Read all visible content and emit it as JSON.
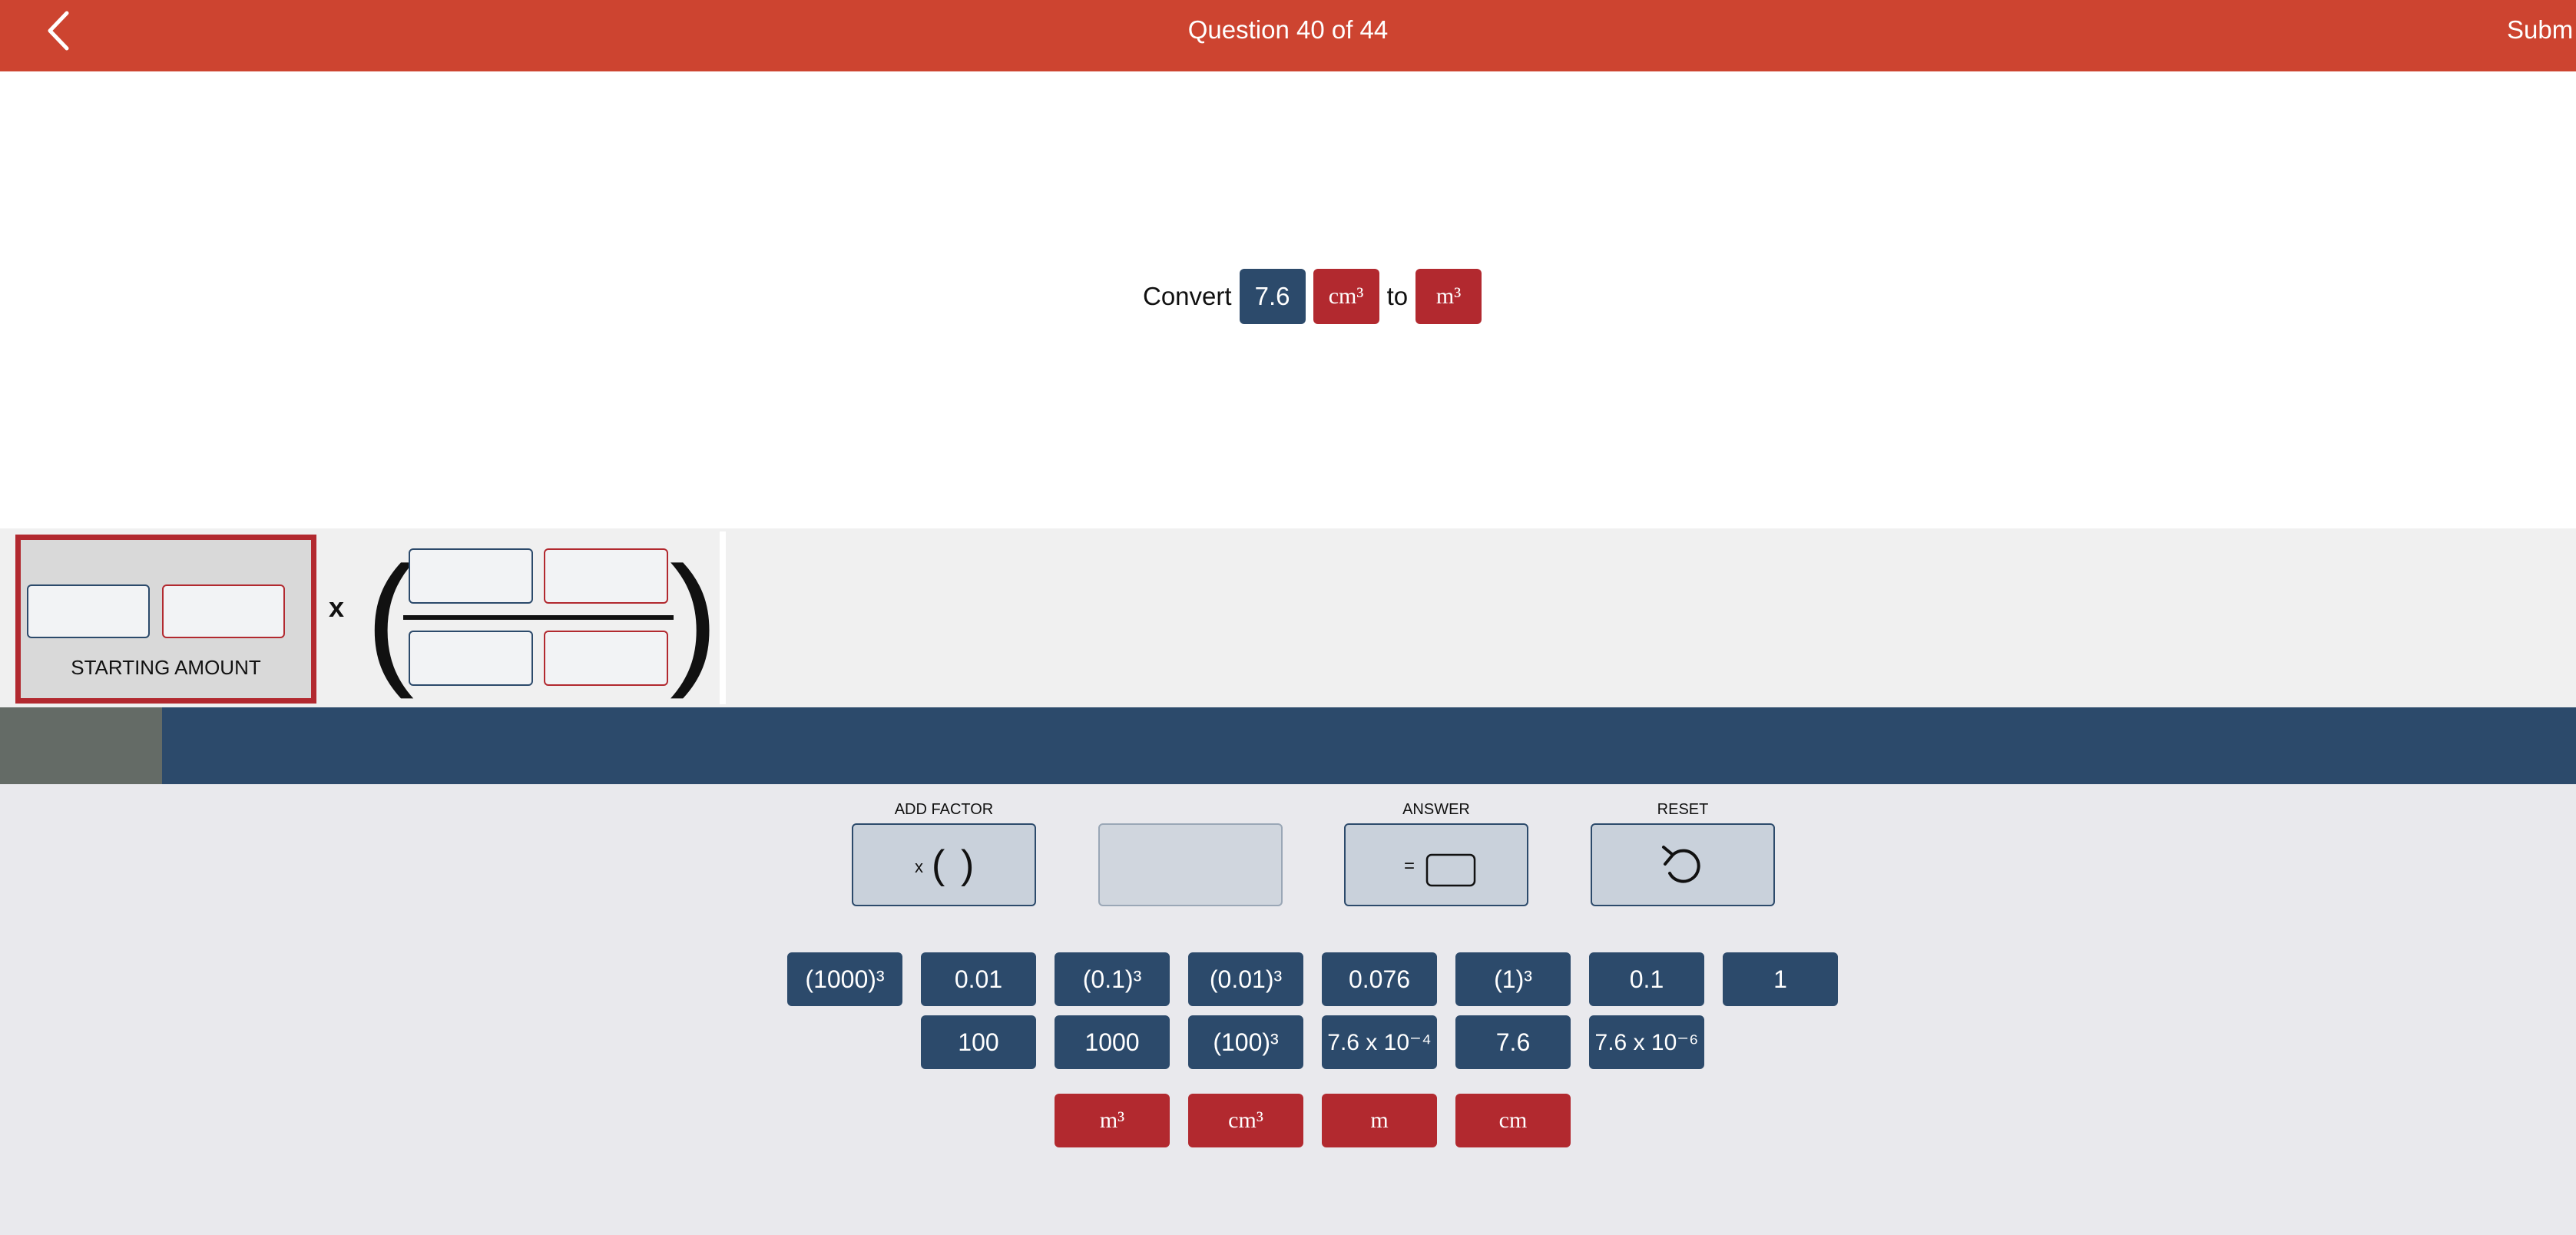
{
  "header": {
    "title": "Question 40 of 44",
    "submit_label": "Subm"
  },
  "question": {
    "prefix": "Convert",
    "value": "7.6",
    "from_unit": "cm³",
    "connector": "to",
    "to_unit": "m³"
  },
  "workspace": {
    "starting_amount_label": "STARTING AMOUNT",
    "multiply_symbol": "x",
    "open_paren": "(",
    "close_paren": ")"
  },
  "progress": {
    "fraction": 0.063
  },
  "controls": {
    "add_factor": {
      "label": "ADD FACTOR",
      "glyph": "x (  )"
    },
    "answer": {
      "label": "ANSWER",
      "glyph": "="
    },
    "reset": {
      "label": "RESET"
    }
  },
  "number_tiles_row1": [
    "(1000)³",
    "0.01",
    "(0.1)³",
    "(0.01)³",
    "0.076",
    "(1)³",
    "0.1",
    "1"
  ],
  "number_tiles_row2": [
    "100",
    "1000",
    "(100)³",
    "7.6 x 10⁻⁴",
    "7.6",
    "7.6 x 10⁻⁶"
  ],
  "unit_tiles": [
    "m³",
    "cm³",
    "m",
    "cm"
  ],
  "colors": {
    "header": "#cd4430",
    "navy": "#2c4a6b",
    "red": "#b2292f"
  }
}
